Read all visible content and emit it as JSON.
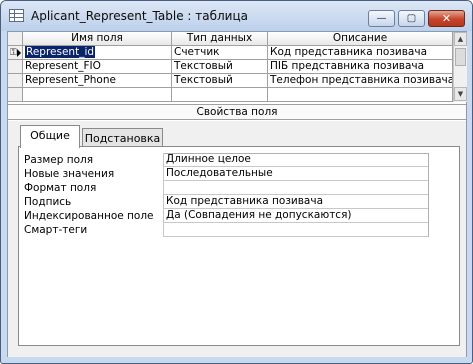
{
  "window": {
    "title": "Aplicant_Represent_Table : таблица",
    "minimize_label": "—",
    "maximize_label": "▢",
    "close_label": "✕"
  },
  "grid": {
    "columns": [
      "Имя поля",
      "Тип данных",
      "Описание"
    ],
    "rows": [
      {
        "name": "Represent_id",
        "type": "Счетчик",
        "description": "Код представника позивача",
        "selected": true,
        "primary_key": true
      },
      {
        "name": "Represent_FIO",
        "type": "Текстовый",
        "description": "ПІБ представника позивача"
      },
      {
        "name": "Represent_Phone",
        "type": "Текстовый",
        "description": "Телефон представника позивача"
      }
    ]
  },
  "properties": {
    "section_label": "Свойства поля",
    "tabs": [
      "Общие",
      "Подстановка"
    ],
    "items": [
      {
        "label": "Размер поля",
        "value": "Длинное целое"
      },
      {
        "label": "Новые значения",
        "value": "Последовательные"
      },
      {
        "label": "Формат поля",
        "value": ""
      },
      {
        "label": "Подпись",
        "value": "Код представника позивача"
      },
      {
        "label": "Индексированное поле",
        "value": "Да (Совпадения не допускаются)"
      },
      {
        "label": "Смарт-теги",
        "value": ""
      }
    ]
  },
  "colors": {
    "title_bar": "#c9d9ef",
    "selection": "#0a246a",
    "close_button": "#c4442b"
  }
}
